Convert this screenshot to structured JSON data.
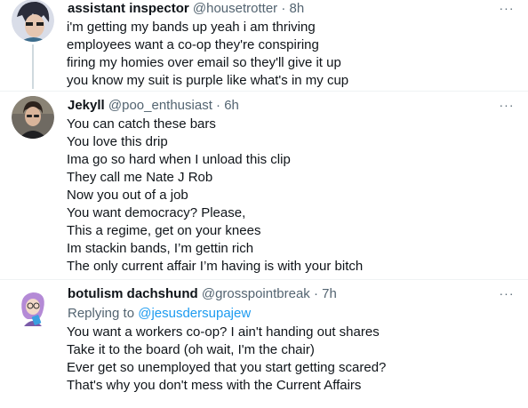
{
  "tweets": [
    {
      "name": "assistant inspector",
      "handle": "@housetrotter",
      "dot": "·",
      "time": "8h",
      "more": "···",
      "lines": [
        "i'm getting my bands up yeah i am thriving",
        "employees want a co-op they're conspiring",
        "firing my homies over email so they'll give it up",
        "you know my suit is purple like what's in my cup"
      ]
    },
    {
      "name": "Jekyll",
      "handle": "@poo_enthusiast",
      "dot": "·",
      "time": "6h",
      "more": "···",
      "lines": [
        "You can catch these bars",
        "You love this drip",
        "Ima go so hard when I unload this clip",
        "They call me Nate J Rob",
        "Now you out of a job",
        "You want democracy? Please,",
        "This a regime, get on your knees",
        "Im stackin bands, I’m gettin rich",
        "The only current affair I’m having is with your bitch"
      ]
    },
    {
      "name": "botulism dachshund",
      "handle": "@grosspointbreak",
      "dot": "·",
      "time": "7h",
      "more": "···",
      "replying_prefix": "Replying to ",
      "replying_to": "@jesusdersupajew",
      "lines": [
        "You want a workers co-op? I ain't handing out shares",
        "Take it to the board (oh wait, I'm the chair)",
        "Ever get so unemployed that you start getting scared?",
        "That's why you don't mess with the Current Affairs"
      ]
    }
  ],
  "colors": {
    "text": "#0f1419",
    "secondary": "#536471",
    "link": "#1d9bf0",
    "thread_line": "#cfd9de"
  },
  "icons": {
    "more": "more-horizontal-icon"
  }
}
